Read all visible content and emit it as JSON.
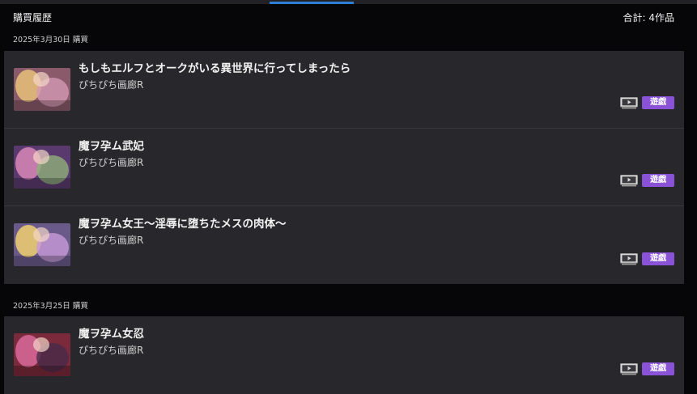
{
  "header": {
    "title": "購買履歴",
    "count": "合計: 4作品"
  },
  "groups": [
    {
      "date": "2025年3月30日 購買",
      "items": [
        {
          "title": "もしもエルフとオークがいる異世界に行ってしまったら",
          "circle": "ぴちぴち画廊R",
          "play_label": "遊戯",
          "thumb_colors": [
            "#8a5a6a",
            "#e8c27a",
            "#d39ab4"
          ]
        },
        {
          "title": "魔ヲ孕ム武妃",
          "circle": "ぴちぴち画廊R",
          "play_label": "遊戯",
          "thumb_colors": [
            "#5a3a6e",
            "#d887b6",
            "#8fb07a"
          ]
        },
        {
          "title": "魔ヲ孕ム女王～淫辱に堕ちたメスの肉体～",
          "circle": "ぴちぴち画廊R",
          "play_label": "遊戯",
          "thumb_colors": [
            "#6a5a8a",
            "#f0d070",
            "#c89ad8"
          ]
        }
      ]
    },
    {
      "date": "2025年3月25日 購買",
      "items": [
        {
          "title": "魔ヲ孕ム女忍",
          "circle": "ぴちぴち画廊R",
          "play_label": "遊戯",
          "thumb_colors": [
            "#7a2a3a",
            "#d86a9a",
            "#4a2a4a"
          ]
        }
      ]
    }
  ],
  "colors": {
    "play_button": "#8a52d6",
    "active_tab": "#2f7fd6",
    "panel": "#28272b"
  },
  "icons": {
    "play_device": "tv-icon"
  }
}
